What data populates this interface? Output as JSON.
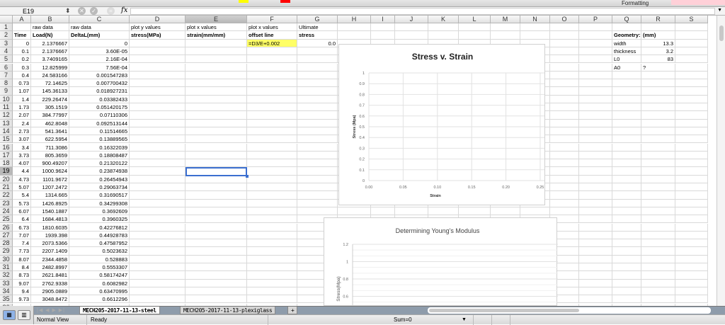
{
  "toolbar": {
    "formatting_label": "Formatting"
  },
  "formula_bar": {
    "name_box": "E19",
    "cancel_icon": "cancel-icon",
    "confirm_icon": "confirm-icon",
    "fx_label": "fx",
    "formula": ""
  },
  "columns": [
    "A",
    "B",
    "C",
    "D",
    "E",
    "F",
    "G",
    "H",
    "I",
    "J",
    "K",
    "L",
    "M",
    "N",
    "O",
    "P",
    "Q",
    "R",
    "S"
  ],
  "selected_cell": {
    "column": "E",
    "row": 19
  },
  "rows": [
    {
      "n": 1,
      "B": "raw data",
      "C": "raw data",
      "D": "plot y values",
      "E": "plot x values",
      "F": "plot x values",
      "G": "Ultimate"
    },
    {
      "n": 2,
      "A": "Time",
      "B": "Load(N)",
      "C": "DeltaL(mm)",
      "D": "stress(MPa)",
      "E": "strain(mm/mm)",
      "F": "offset line",
      "G": "stress",
      "Q": "Geometry:",
      "R": "(mm)"
    },
    {
      "n": 3,
      "A": "0",
      "B": "2.1376667",
      "C": "0",
      "F": "=D3/E+0.002",
      "G": "0.0",
      "Q": "width",
      "R": "13.3"
    },
    {
      "n": 4,
      "A": "0.1",
      "B": "2.1376667",
      "C": "3.60E-05",
      "Q": "thickness",
      "R": "3.2"
    },
    {
      "n": 5,
      "A": "0.2",
      "B": "3.7409165",
      "C": "2.16E-04",
      "Q": "L0",
      "R": "83"
    },
    {
      "n": 6,
      "A": "0.3",
      "B": "12.825999",
      "C": "7.56E-04",
      "Q": "A0",
      "R": "?"
    },
    {
      "n": 7,
      "A": "0.4",
      "B": "24.583166",
      "C": "0.001547283"
    },
    {
      "n": 8,
      "A": "0.73",
      "B": "72.14625",
      "C": "0.007700432"
    },
    {
      "n": 9,
      "A": "1.07",
      "B": "145.36133",
      "C": "0.018927231"
    },
    {
      "n": 10,
      "A": "1.4",
      "B": "229.26474",
      "C": "0.03382433"
    },
    {
      "n": 11,
      "A": "1.73",
      "B": "305.1519",
      "C": "0.051420175"
    },
    {
      "n": 12,
      "A": "2.07",
      "B": "384.77997",
      "C": "0.07110306"
    },
    {
      "n": 13,
      "A": "2.4",
      "B": "462.8048",
      "C": "0.092513144"
    },
    {
      "n": 14,
      "A": "2.73",
      "B": "541.3641",
      "C": "0.11514665"
    },
    {
      "n": 15,
      "A": "3.07",
      "B": "622.5954",
      "C": "0.13889565"
    },
    {
      "n": 16,
      "A": "3.4",
      "B": "711.3086",
      "C": "0.16322039"
    },
    {
      "n": 17,
      "A": "3.73",
      "B": "805.3659",
      "C": "0.18808487"
    },
    {
      "n": 18,
      "A": "4.07",
      "B": "900.49207",
      "C": "0.21320122"
    },
    {
      "n": 19,
      "A": "4.4",
      "B": "1000.9624",
      "C": "0.23874938"
    },
    {
      "n": 20,
      "A": "4.73",
      "B": "1101.9672",
      "C": "0.26454943"
    },
    {
      "n": 21,
      "A": "5.07",
      "B": "1207.2472",
      "C": "0.29063734"
    },
    {
      "n": 22,
      "A": "5.4",
      "B": "1314.665",
      "C": "0.31690517"
    },
    {
      "n": 23,
      "A": "5.73",
      "B": "1426.8925",
      "C": "0.34299308"
    },
    {
      "n": 24,
      "A": "6.07",
      "B": "1540.1887",
      "C": "0.3692609"
    },
    {
      "n": 25,
      "A": "6.4",
      "B": "1684.4813",
      "C": "0.3960325"
    },
    {
      "n": 26,
      "A": "6.73",
      "B": "1810.6035",
      "C": "0.42276812"
    },
    {
      "n": 27,
      "A": "7.07",
      "B": "1939.398",
      "C": "0.44928783"
    },
    {
      "n": 28,
      "A": "7.4",
      "B": "2073.5366",
      "C": "0.47587952"
    },
    {
      "n": 29,
      "A": "7.73",
      "B": "2207.1409",
      "C": "0.5023632"
    },
    {
      "n": 30,
      "A": "8.07",
      "B": "2344.4858",
      "C": "0.528883"
    },
    {
      "n": 31,
      "A": "8.4",
      "B": "2482.8997",
      "C": "0.5553307"
    },
    {
      "n": 32,
      "A": "8.73",
      "B": "2621.8481",
      "C": "0.58174247"
    },
    {
      "n": 33,
      "A": "9.07",
      "B": "2762.9338",
      "C": "0.6082982"
    },
    {
      "n": 34,
      "A": "9.4",
      "B": "2905.0889",
      "C": "0.63470995"
    },
    {
      "n": 35,
      "A": "9.73",
      "B": "3048.8472",
      "C": "0.6612296"
    }
  ],
  "chart_data": [
    {
      "type": "scatter",
      "title": "Stress v. Strain",
      "xlabel": "Strain",
      "ylabel": "Stress (Mpa)",
      "xlim": [
        0,
        0.25
      ],
      "ylim": [
        0,
        1
      ],
      "xticks": [
        "0.00",
        "0.05",
        "0.10",
        "0.15",
        "0.20",
        "0.25"
      ],
      "yticks": [
        "0",
        "0.1",
        "0.2",
        "0.3",
        "0.4",
        "0.5",
        "0.6",
        "0.7",
        "0.8",
        "0.9",
        "1"
      ],
      "grid": true,
      "series": []
    },
    {
      "type": "scatter",
      "title": "Determining Young's Modulus",
      "xlabel": "",
      "ylabel": "Stress(Mpa)",
      "ylim": [
        0,
        1.2
      ],
      "yticks": [
        "0.6",
        "0.8",
        "1",
        "1.2"
      ],
      "grid": true,
      "series": []
    }
  ],
  "sheet_tabs": [
    {
      "label": "MECH205-2017-11-13-steel",
      "active": true
    },
    {
      "label": "MECH205-2017-11-13-plexiglass",
      "active": false
    }
  ],
  "add_sheet_label": "+",
  "status": {
    "view": "Normal View",
    "state": "Ready",
    "sum": "Sum=0"
  }
}
